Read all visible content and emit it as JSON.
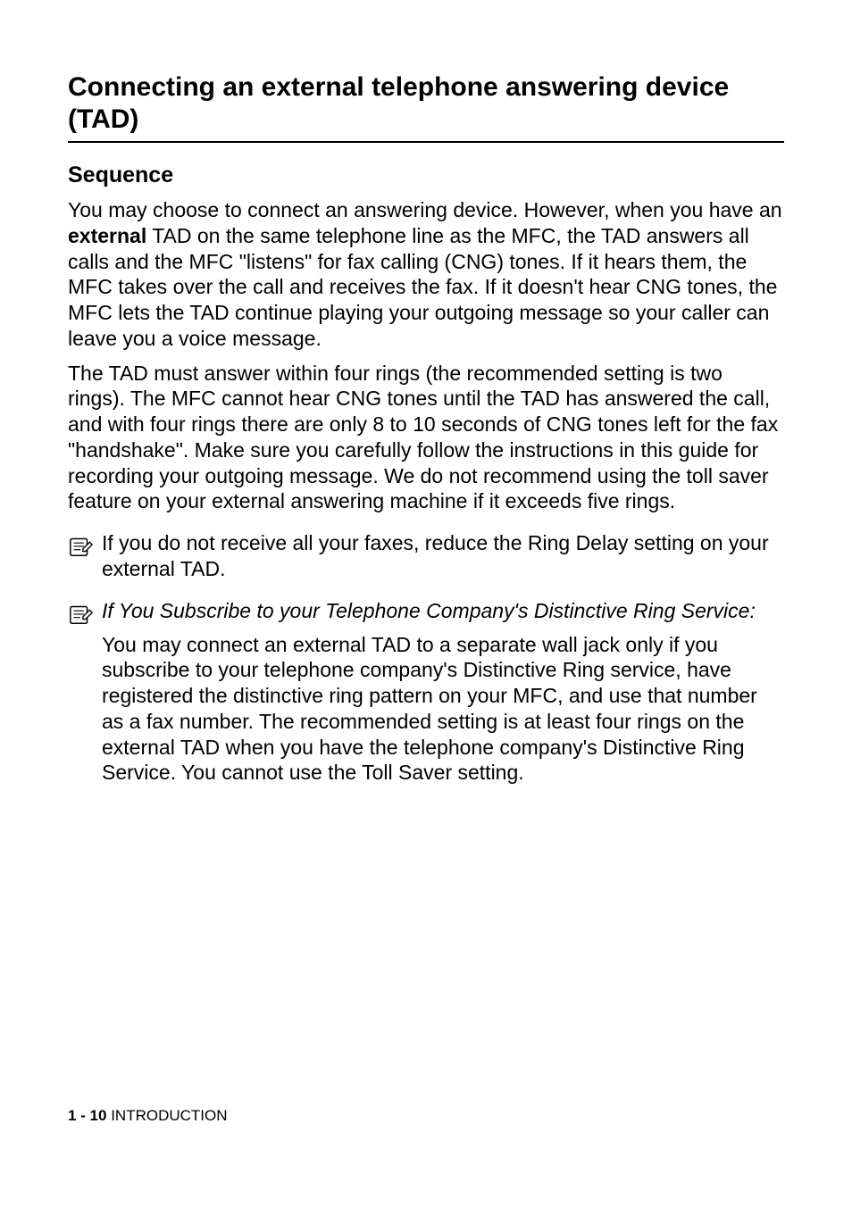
{
  "headings": {
    "main": "Connecting an external telephone answering device (TAD)",
    "sub": "Sequence"
  },
  "paragraphs": {
    "p1_a": "You may choose to connect an answering device. However, when you have an ",
    "p1_bold": "external",
    "p1_b": " TAD on the same telephone line as the MFC, the TAD answers all calls and the MFC \"listens\" for fax calling (CNG) tones. If it hears them, the MFC takes over the call and receives the fax. If it doesn't hear CNG tones, the MFC lets the TAD continue playing your outgoing message so your caller can leave you a voice message.",
    "p2": "The TAD must answer within four rings (the recommended setting is two rings). The MFC cannot hear CNG tones until the TAD has answered the call, and with four rings there are only 8 to 10 seconds of CNG tones left for the fax \"handshake\". Make sure you carefully follow the instructions in this guide for recording your outgoing message. We do not recommend using the toll saver feature on your external answering machine if it exceeds five rings."
  },
  "notes": {
    "n1": "If you do not receive all your faxes, reduce the Ring Delay setting on your external TAD.",
    "n2_italic": "If You Subscribe to your Telephone Company's Distinctive Ring Service:",
    "n2_follow": "You may connect an external TAD to a separate wall jack only if you subscribe to your telephone company's Distinctive Ring service, have registered the distinctive ring pattern on your MFC, and use that number as a fax number. The recommended setting is at least four rings on the external TAD when you have the telephone company's Distinctive Ring Service. You cannot use the Toll Saver setting."
  },
  "footer": {
    "page": "1 - 10",
    "section": "   INTRODUCTION"
  },
  "icons": {
    "note_icon_name": "note-pencil-icon"
  }
}
